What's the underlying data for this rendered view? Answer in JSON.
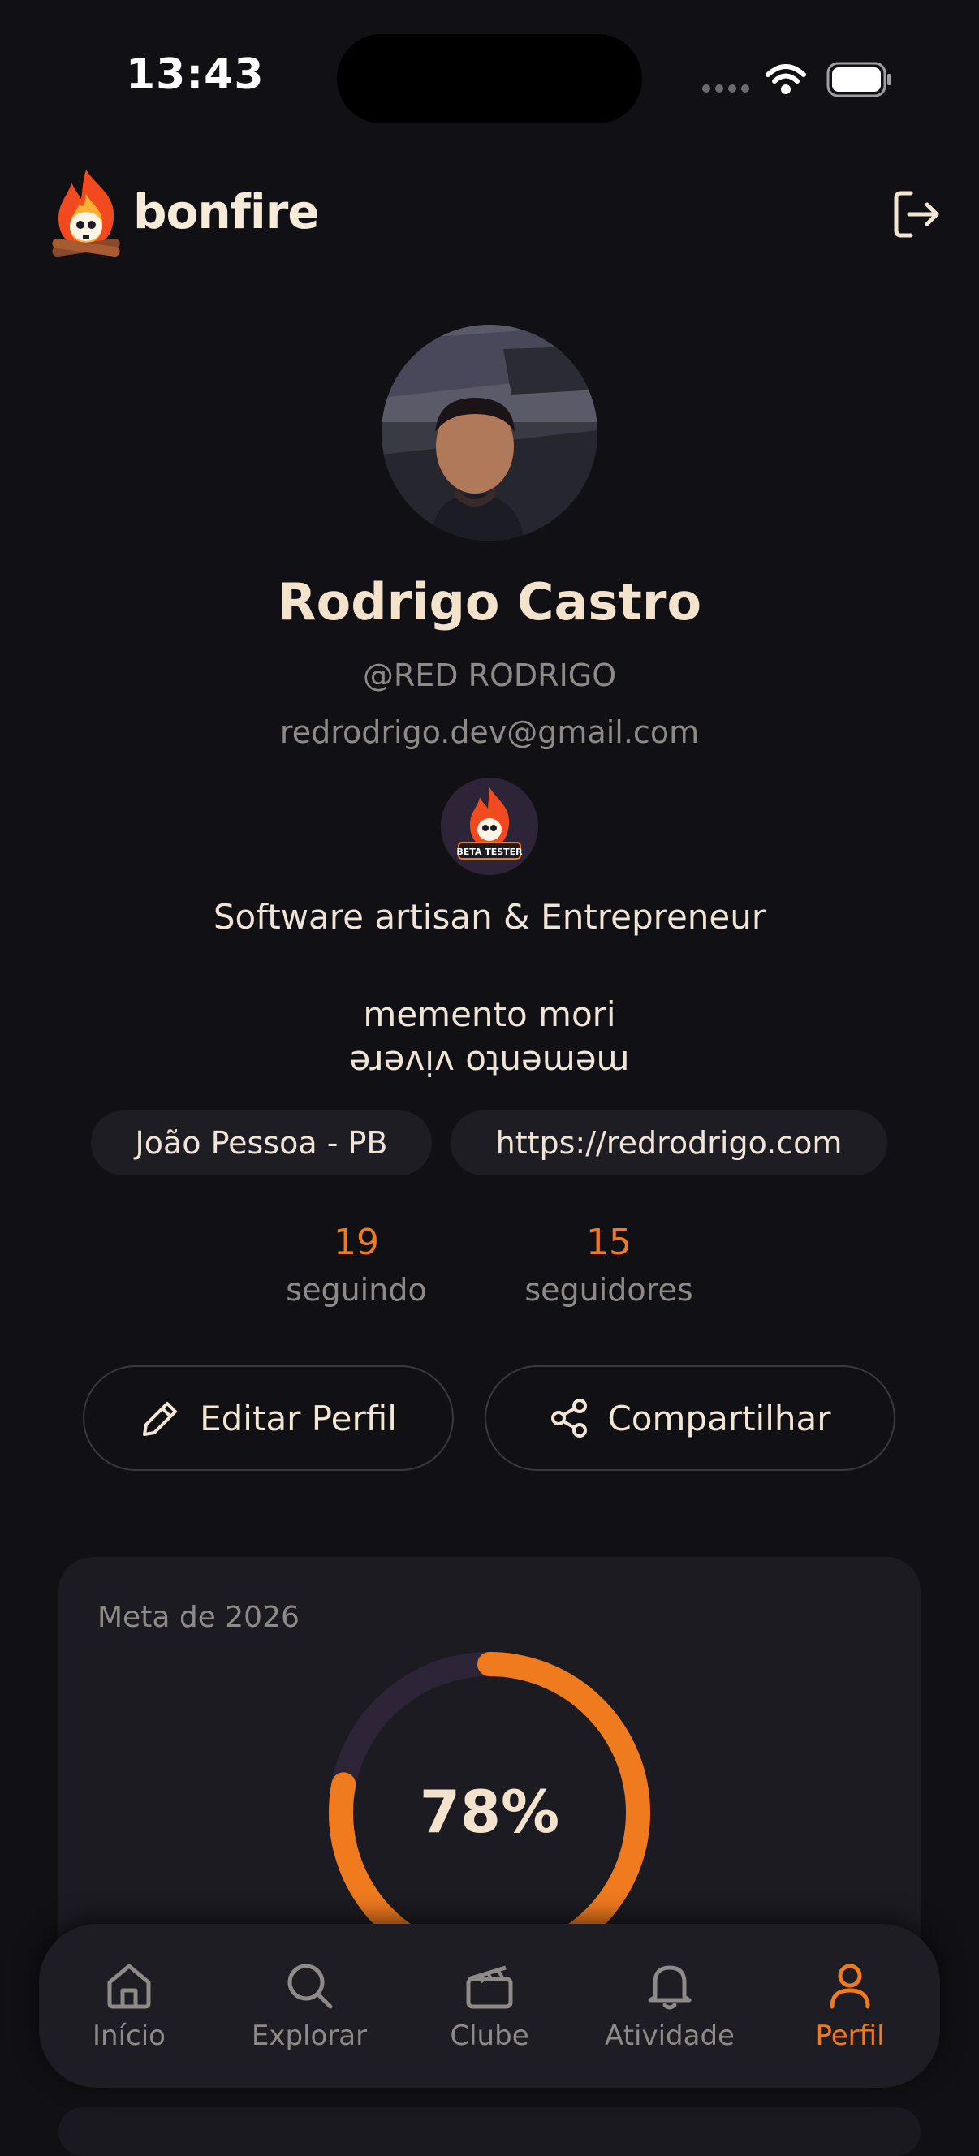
{
  "status_bar": {
    "time": "13:43"
  },
  "header": {
    "brand": "bonfire",
    "logout_icon": "logout-icon"
  },
  "profile": {
    "name": "Rodrigo Castro",
    "handle": "@RED RODRIGO",
    "email": "redrodrigo.dev@gmail.com",
    "badge": "BETA TESTER",
    "bio_line1": "Software artisan & Entrepreneur",
    "bio_line2": "memento mori",
    "bio_line3": "memento vivere",
    "location": "João Pessoa - PB",
    "website": "https://redrodrigo.com"
  },
  "stats": {
    "following_count": "19",
    "following_label": "seguindo",
    "followers_count": "15",
    "followers_label": "seguidores"
  },
  "actions": {
    "edit_label": "Editar Perfil",
    "share_label": "Compartilhar"
  },
  "goal": {
    "title": "Meta de 2026",
    "percent_label": "78%",
    "progress": 0.78
  },
  "tabs": [
    {
      "label": "Início",
      "icon": "home-icon",
      "active": false
    },
    {
      "label": "Explorar",
      "icon": "search-icon",
      "active": false
    },
    {
      "label": "Clube",
      "icon": "clapperboard-icon",
      "active": false
    },
    {
      "label": "Atividade",
      "icon": "bell-icon",
      "active": false
    },
    {
      "label": "Perfil",
      "icon": "user-icon",
      "active": true
    }
  ],
  "colors": {
    "accent": "#f07a1e",
    "background": "#111014",
    "card": "#1c1b22",
    "ring_track": "#2e2438"
  }
}
